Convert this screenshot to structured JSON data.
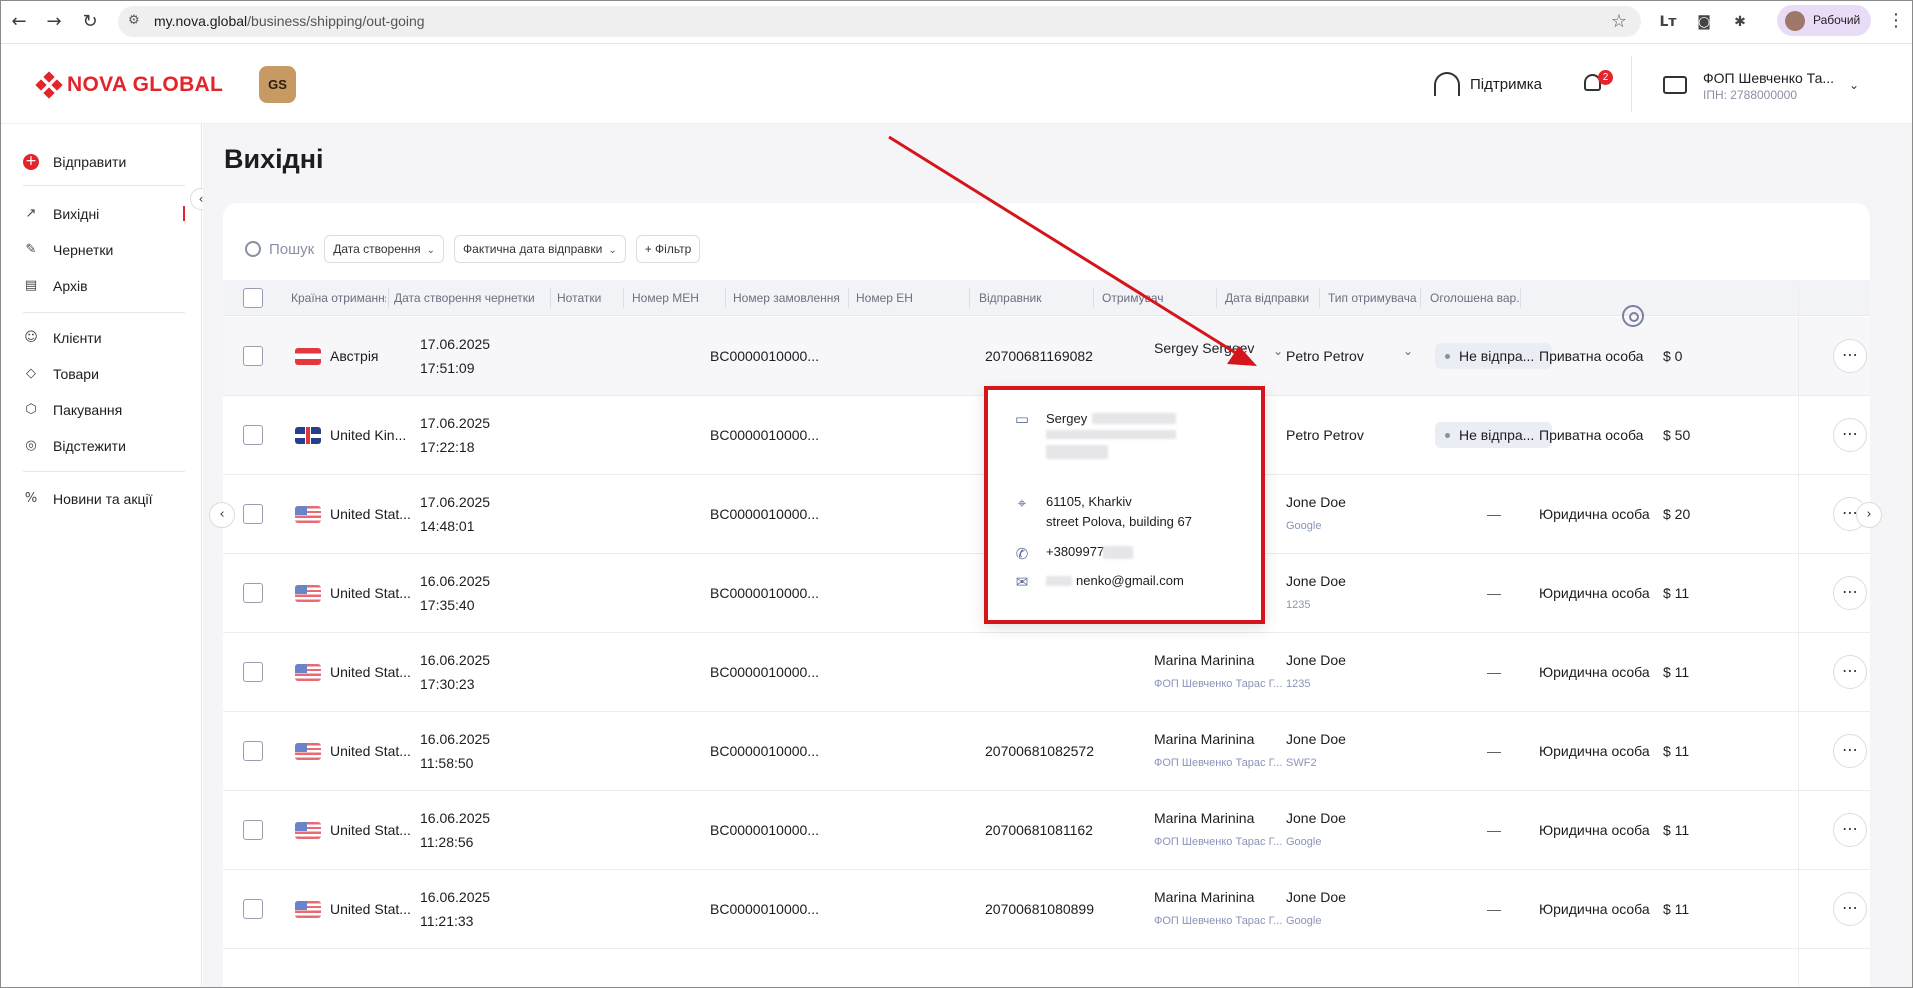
{
  "browser": {
    "url_domain": "my.nova.global",
    "url_path": "/business/shipping/out-going",
    "profile_label": "Рабочий",
    "ext_label": "Lт"
  },
  "header": {
    "logo_text": "NOVA GLOBAL",
    "gs_badge": "GS",
    "support_label": "Підтримка",
    "notifications_count": "2",
    "account_name": "ФОП Шевченко Та...",
    "account_inn": "ІПН: 2788000000"
  },
  "sidebar": {
    "items": [
      {
        "label": "Відправити",
        "icon": "plus-icon"
      },
      {
        "label": "Вихідні",
        "icon": "arrow-up-left-icon"
      },
      {
        "label": "Чернетки",
        "icon": "edit-icon"
      },
      {
        "label": "Архів",
        "icon": "archive-icon"
      },
      {
        "label": "Клієнти",
        "icon": "users-icon"
      },
      {
        "label": "Товари",
        "icon": "tag-icon"
      },
      {
        "label": "Пакування",
        "icon": "box-icon"
      },
      {
        "label": "Відстежити",
        "icon": "target-icon"
      },
      {
        "label": "Новини та акції",
        "icon": "percent-icon"
      }
    ]
  },
  "page": {
    "title": "Вихідні",
    "search_placeholder": "Пошук",
    "filters": [
      "Дата створення",
      "Фактична дата відправки",
      "+ Фільтр"
    ]
  },
  "table": {
    "columns": [
      "Країна отримання",
      "Дата створення чернетки",
      "Нотатки",
      "Номер МЕН",
      "Номер замовлення",
      "Номер ЕН",
      "Відправник",
      "Отримувач",
      "Дата відправки",
      "Тип отримувача",
      "Оголошена вар..."
    ],
    "rows": [
      {
        "country": "Австрія",
        "flag": "at",
        "date": "17.06.2025",
        "time": "17:51:09",
        "men": "BC0000010000...",
        "en": "20700681169082",
        "sender": "Sergey Sergeev",
        "sender_sub": "",
        "recipient": "Petro Petrov",
        "recipient_sub": "",
        "ship_date": "Не відпра...",
        "type": "Приватна особа",
        "value": "$ 0"
      },
      {
        "country": "United Kin...",
        "flag": "uk",
        "date": "17.06.2025",
        "time": "17:22:18",
        "men": "BC0000010000...",
        "en": "",
        "sender": "",
        "sender_sub": "",
        "recipient": "Petro Petrov",
        "recipient_sub": "",
        "ship_date": "Не відпра...",
        "type": "Приватна особа",
        "value": "$ 50"
      },
      {
        "country": "United Stat...",
        "flag": "us",
        "date": "17.06.2025",
        "time": "14:48:01",
        "men": "BC0000010000...",
        "en": "",
        "sender": "",
        "sender_sub": "",
        "recipient": "Jone Doe",
        "recipient_sub": "Google",
        "ship_date": "—",
        "type": "Юридична особа",
        "value": "$ 20"
      },
      {
        "country": "United Stat...",
        "flag": "us",
        "date": "16.06.2025",
        "time": "17:35:40",
        "men": "BC0000010000...",
        "en": "",
        "sender": "",
        "sender_sub": "",
        "recipient": "Jone Doe",
        "recipient_sub": "1235",
        "ship_date": "—",
        "type": "Юридична особа",
        "value": "$ 11"
      },
      {
        "country": "United Stat...",
        "flag": "us",
        "date": "16.06.2025",
        "time": "17:30:23",
        "men": "BC0000010000...",
        "en": "",
        "sender": "Marina Marinina",
        "sender_sub": "ФОП Шевченко Тарас Г...",
        "recipient": "Jone Doe",
        "recipient_sub": "1235",
        "ship_date": "—",
        "type": "Юридична особа",
        "value": "$ 11"
      },
      {
        "country": "United Stat...",
        "flag": "us",
        "date": "16.06.2025",
        "time": "11:58:50",
        "men": "BC0000010000...",
        "en": "20700681082572",
        "sender": "Marina Marinina",
        "sender_sub": "ФОП Шевченко Тарас Г...",
        "recipient": "Jone Doe",
        "recipient_sub": "SWF2",
        "ship_date": "—",
        "type": "Юридична особа",
        "value": "$ 11"
      },
      {
        "country": "United Stat...",
        "flag": "us",
        "date": "16.06.2025",
        "time": "11:28:56",
        "men": "BC0000010000...",
        "en": "20700681081162",
        "sender": "Marina Marinina",
        "sender_sub": "ФОП Шевченко Тарас Г...",
        "recipient": "Jone Doe",
        "recipient_sub": "Google",
        "ship_date": "—",
        "type": "Юридична особа",
        "value": "$ 11"
      },
      {
        "country": "United Stat...",
        "flag": "us",
        "date": "16.06.2025",
        "time": "11:21:33",
        "men": "BC0000010000...",
        "en": "20700681080899",
        "sender": "Marina Marinina",
        "sender_sub": "ФОП Шевченко Тарас Г...",
        "recipient": "Jone Doe",
        "recipient_sub": "Google",
        "ship_date": "—",
        "type": "Юридична особа",
        "value": "$ 11"
      }
    ]
  },
  "sender_popup": {
    "name": "Sergey",
    "address_line1": "61105, Kharkiv",
    "address_line2": "street Polova, building 67",
    "phone": "+3809977",
    "email": "nenko@gmail.com"
  },
  "colors": {
    "accent": "#e3242b",
    "annotation": "#d4151c"
  }
}
